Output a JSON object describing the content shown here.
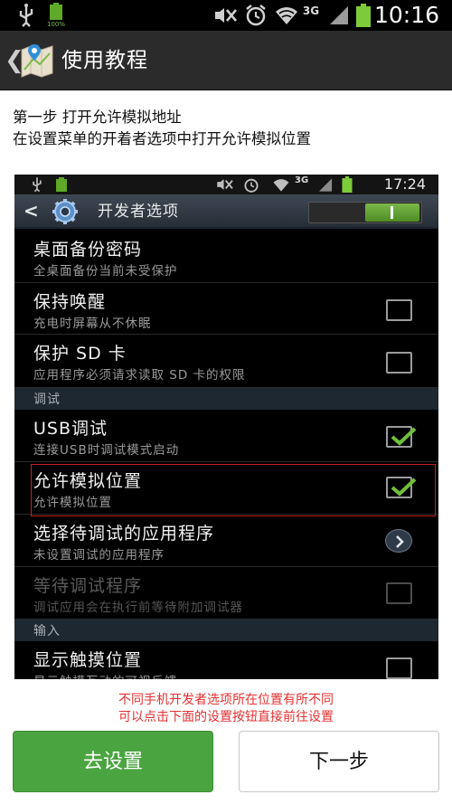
{
  "status_bar": {
    "time": "10:16",
    "battery_percent": "100%",
    "network": "3G",
    "icons": [
      "usb-icon",
      "battery-full-icon",
      "mute-icon",
      "alarm-icon",
      "wifi-icon",
      "signal-icon",
      "battery-icon"
    ]
  },
  "header": {
    "back_glyph": "❮",
    "title": "使用教程"
  },
  "instructions": {
    "line1": "第一步 打开允许模拟地址",
    "line2": "在设置菜单的开着者选项中打开允许模拟位置"
  },
  "embedded_screenshot": {
    "status_time": "17:24",
    "status_network": "3G",
    "title": "开发者选项",
    "toggle_on": true,
    "items": [
      {
        "title": "桌面备份密码",
        "subtitle": "全桌面备份当前未受保护"
      },
      {
        "title": "保持唤醒",
        "subtitle": "充电时屏幕从不休眠",
        "checked": false
      },
      {
        "title": "保护 SD 卡",
        "subtitle": "应用程序必须请求读取 SD 卡的权限",
        "checked": false
      },
      {
        "section": "调试"
      },
      {
        "title": "USB调试",
        "subtitle": "连接USB时调试模式启动",
        "checked": true
      },
      {
        "title": "允许模拟位置",
        "subtitle": "允许模拟位置",
        "checked": true
      },
      {
        "title": "选择待调试的应用程序",
        "subtitle": "未设置调试的应用程序"
      },
      {
        "title": "等待调试程序",
        "subtitle": "调试应用会在执行前等待附加调试器",
        "checked": false,
        "disabled": true
      },
      {
        "section": "输入"
      },
      {
        "title": "显示触摸位置",
        "subtitle": "显示触摸互动的可视反馈",
        "checked": false
      }
    ]
  },
  "notes": {
    "line1": "不同手机开发者选项所在位置有所不同",
    "line2": "可以点击下面的设置按钮直接前往设置"
  },
  "buttons": {
    "go_settings": "去设置",
    "next_step": "下一步"
  },
  "colors": {
    "accent_green": "#4aa540",
    "note_red": "#e63030",
    "highlight_red": "#c51f1f"
  }
}
